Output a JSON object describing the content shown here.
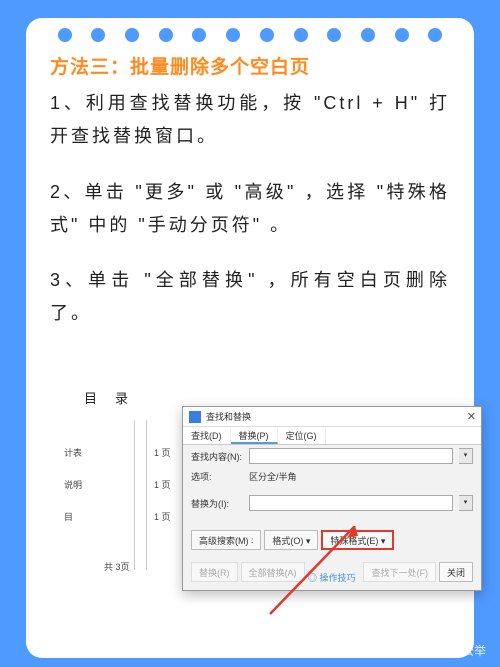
{
  "title": "方法三：批量删除多个空白页",
  "steps": {
    "s1": "1、利用查找替换功能，按 \"Ctrl + H\" 打开查找替换窗口。",
    "s2": "2、单击 \"更多\" 或 \"高级\" ，选择 \"特殊格式\" 中的 \"手动分页符\" 。",
    "s3": "3、单击 \"全部替换\" ，所有空白页删除了。"
  },
  "doc": {
    "heading": "目录",
    "rows": [
      {
        "label": "计表",
        "page": "1 页"
      },
      {
        "label": "说明",
        "page": "1 页"
      },
      {
        "label": "目",
        "page": "1 页"
      }
    ],
    "total": "共 3页"
  },
  "dialog": {
    "title": "查找和替换",
    "tabs": {
      "find": "查找(D)",
      "replace": "替换(P)",
      "goto": "定位(G)"
    },
    "find_label": "查找内容(N):",
    "options_label": "选项:",
    "options_value": "区分全/半角",
    "replace_label": "替换为(I):",
    "buttons": {
      "advanced": "高级搜索(M) ∶",
      "format": "格式(O) ▾",
      "special": "特殊格式(E) ▾",
      "replace": "替换(R)",
      "replace_all": "全部替换(A)",
      "find_next": "查找下一处(F)",
      "close": "关闭"
    },
    "tip": "◎ 操作技巧"
  },
  "watermark": "@通讯信息小公举"
}
